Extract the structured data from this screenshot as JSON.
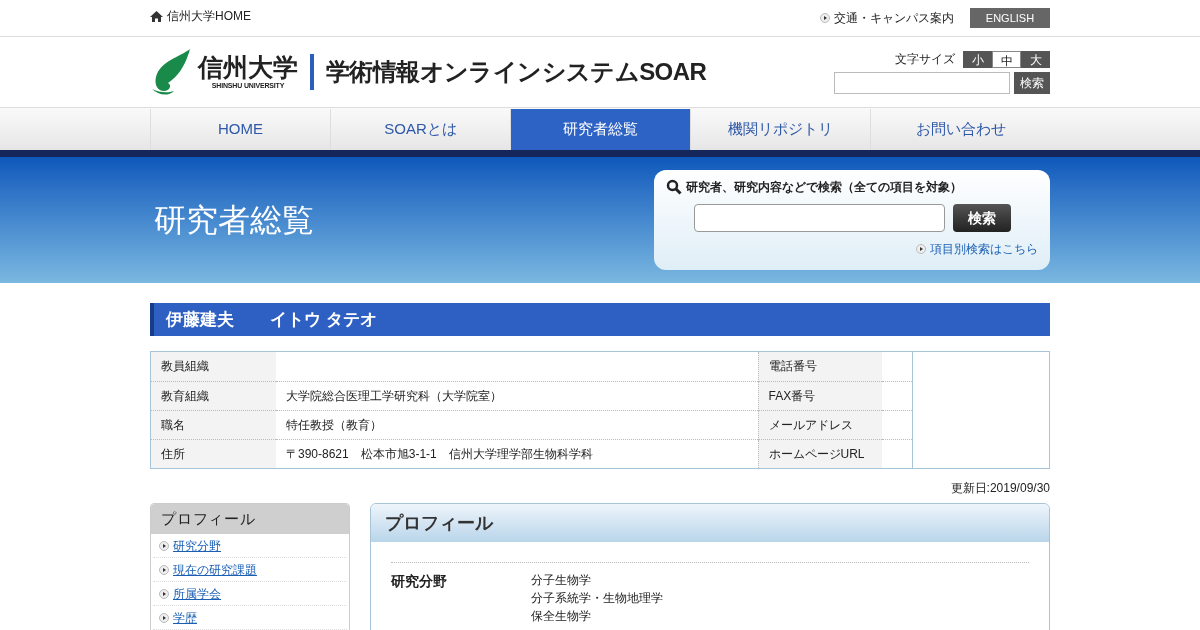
{
  "top_bar": {
    "home_link": "信州大学HOME",
    "access_link": "交通・キャンパス案内",
    "language_button": "ENGLISH"
  },
  "header": {
    "logo_name": "信州大学",
    "logo_subtitle": "SHINSHU UNIVERSITY",
    "site_title": "学術情報オンラインシステムSOAR",
    "font_size_label": "文字サイズ",
    "font_sizes": [
      {
        "label": "小",
        "selected": false
      },
      {
        "label": "中",
        "selected": true
      },
      {
        "label": "大",
        "selected": false
      }
    ],
    "search_button": "検索"
  },
  "nav": [
    {
      "label": "HOME",
      "selected": false
    },
    {
      "label": "SOARとは",
      "selected": false
    },
    {
      "label": "研究者総覧",
      "selected": true
    },
    {
      "label": "機関リポジトリ",
      "selected": false
    },
    {
      "label": "お問い合わせ",
      "selected": false
    }
  ],
  "banner": {
    "title": "研究者総覧",
    "search_heading": "研究者、研究内容などで検索（全ての項目を対象）",
    "search_button": "検索",
    "advanced_link": "項目別検索はこちら"
  },
  "researcher": {
    "name": "伊藤建夫",
    "kana": "イトウ タテオ"
  },
  "info_table": [
    {
      "label": "教員組織",
      "label2": "電話番号"
    },
    {
      "label": "教育組織",
      "value": "大学院総合医理工学研究科（大学院室）",
      "label2": "FAX番号"
    },
    {
      "label": "職名",
      "value": "特任教授（教育）",
      "label2": "メールアドレス"
    },
    {
      "label": "住所",
      "value": "〒390-8621　松本市旭3-1-1　信州大学理学部生物科学科",
      "label2": "ホームページURL"
    }
  ],
  "updated": "更新日:2019/09/30",
  "sidebar": {
    "title": "プロフィール",
    "items": [
      "研究分野",
      "現在の研究課題",
      "所属学会",
      "学歴"
    ]
  },
  "profile": {
    "title": "プロフィール",
    "rows": [
      {
        "label": "研究分野",
        "values": [
          "分子生物学",
          "分子系統学・生物地理学",
          "保全生物学"
        ]
      }
    ]
  }
}
